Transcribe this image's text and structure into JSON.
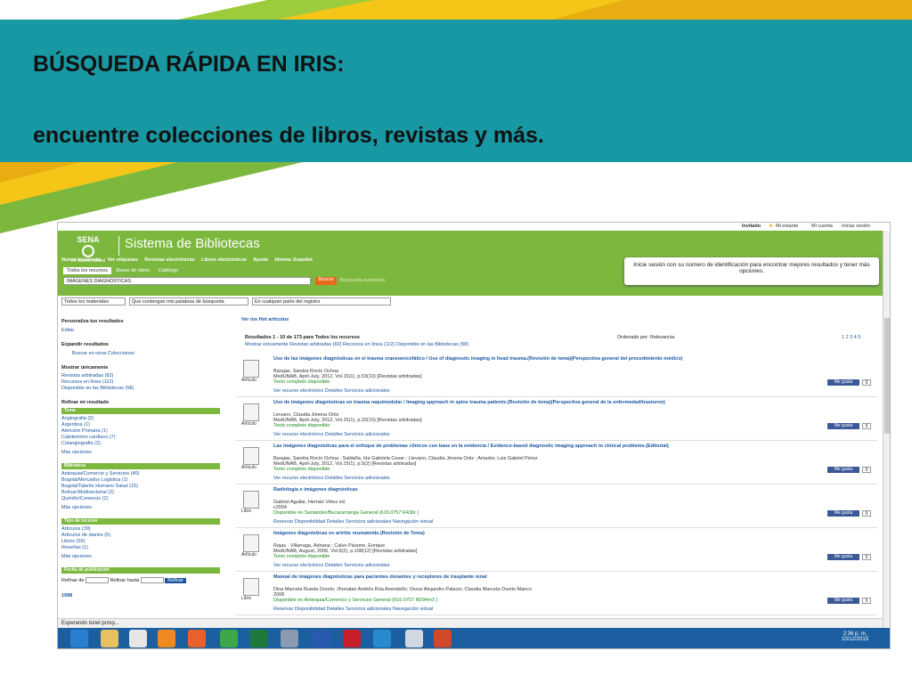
{
  "slide": {
    "title1": "BÚSQUEDA  RÁPIDA EN IRIS:",
    "title2": "encuentre colecciones de libros, revistas y más."
  },
  "topbar": {
    "invitado": "Invitado",
    "estante": "Mi estante",
    "cuenta": "Mi cuenta",
    "iniciar": "Iniciar sesión"
  },
  "header": {
    "logo_text": "SENA",
    "logo_sub": "De clase mundial",
    "system_title": "Sistema de Bibliotecas",
    "nav": [
      "Nueva búsqueda",
      "Ver etiquetas",
      "Revistas electrónicas",
      "Libros electrónicos",
      "Ayuda",
      "Idioma: Español"
    ],
    "tabs": [
      "Todos los recursos",
      "Bases de datos",
      "Catálogo"
    ],
    "search_value": "IMÁGENES DIAGNÓSTICAS",
    "search_button": "Buscar",
    "advanced": "Búsqueda avanzada",
    "login_message": "Inicie sesión con su número de identificación para encontrar mejores resultados y tener más opciones."
  },
  "filters": [
    "Todos los materiales",
    "Que contengan mis palabras de búsqueda",
    "En cualquier parte del registro"
  ],
  "sidebar": {
    "personaliza": "Personaliza tus resultados",
    "editar": "Editar",
    "expandir": "Expandir resultados",
    "buscar_otras": "Buscar en otras Colecciones",
    "mostrar": "Mostrar únicamente",
    "mostrar_items": [
      "Revistas arbitradas (82)",
      "Recursos en línea (112)",
      "Disponible en las Bibliotecas (58)"
    ],
    "refinar": "Refinar mi resultado",
    "tema": "Tema",
    "tema_items": [
      "Angiografia (2)",
      "Argentina (1)",
      "Atención Primaria (1)",
      "Cateterismo cardíaco (7)",
      "Colangiografia (2)"
    ],
    "mas": "Más opciones",
    "biblioteca": "Biblioteca",
    "biblioteca_items": [
      "Antioquia/Comercio y Servicios (40)",
      "Bogotá/Mercados Logistica (1)",
      "Bogotá/Talento Humano Salud (15)",
      "Bolívar/Multisectorial (2)",
      "Quindío/Comercio (2)"
    ],
    "tipo": "Tipo de recurso",
    "tipo_items": [
      "Artículos (39)",
      "Artículos de diarios (5)",
      "Libros (59)",
      "Reseñas (1)"
    ],
    "fecha": "Fecha de publicación",
    "refinar_de": "Refinar de",
    "refinar_hasta": "Refinar hasta",
    "refinar_btn": "Refinar",
    "year": "1998"
  },
  "results": {
    "ver": "Ver los Hot artículos",
    "summary": "Resultados 1 - 10 de 173  para Todos los recursos",
    "mostrar_line": "Mostrar únicamente   Revistas arbitradas (82)   Recursos en línea (112)   Disponible en las Bibliotecas (58)",
    "orden": "Ordenado por: Relevancia",
    "pages": "1 2 3 4 5",
    "items": [
      {
        "type": "Artículo",
        "title": "Uso de las imágenes diagnósticas en el trauma craneoencefálico / Use of diagnostic imaging in head trauma.(Revisión de tema)(Perspectiva general del procedimiento médico)",
        "authors": "Barajas, Sandra Rocío Ochoa",
        "source": "MedUNAB, April-July, 2012, Vol.15(1), p.53(10) [Revistas arbitradas]",
        "avail": "Texto completo disponible",
        "links": "Ver recurso electrónico    Detalles    Servicios adicionales"
      },
      {
        "type": "Artículo",
        "title": "Uso de imágenes diagnósticas en trauma raquimedular / Imaging approach in spine trauma patients.(Revisión de tema)(Perspectiva general de la enfermedad/trastorno)",
        "authors": "Llevano, Claudia Jimena Ortiz",
        "source": "MedUNAB, April-July, 2012, Vol.15(1), p.22(10) [Revistas arbitradas]",
        "avail": "Texto completo disponible",
        "links": "Ver recurso electrónico    Detalles    Servicios adicionales"
      },
      {
        "type": "Artículo",
        "title": "Las imágenes diagnósticas para el enfoque de problemas clínicos con base en la evidencia / Evidence-based diagnostic imaging approach to clinical problems.(Editorial)",
        "authors": "Barajas, Sandra Rocío Ochoa ; Saldaña, Ida Gabriela Cesar ; Llevano, Claudia Jimena Ortiz ; Amador, Luis Gabriel Pérez",
        "source": "MedUNAB, April-July, 2012, Vol.15(1), p.5(2) [Revistas arbitradas]",
        "avail": "Texto completo disponible",
        "links": "Ver recurso electrónico    Detalles    Servicios adicionales"
      },
      {
        "type": "Libro",
        "title": "Radiología e imágenes diagnósticas",
        "authors": "Gabriel Aguilar, Hernán Vélez ed.",
        "source": "c2004",
        "avail": "Disponible en Santander/Bucaramanga General (616.0757 R436r )",
        "links": "Reservar    Disponibilidad    Detalles    Servicios adicionales    Navegación virtual"
      },
      {
        "type": "Artículo",
        "title": "Imágenes diagnósticas en artritis reumatoide.(Revisión de Tema)",
        "authors": "Rojas - Villarraga, Adriana ; Calvo Páramo, Enrique",
        "source": "MedUNAB, August, 2006, Vol.9(2), p.108(12) [Revistas arbitradas]",
        "avail": "Texto completo disponible",
        "links": "Ver recurso electrónico    Detalles    Servicios adicionales"
      },
      {
        "type": "Libro",
        "title": "Manual de imágenes diagnósticas para pacientes donantes y receptores de trasplante renal",
        "authors": "Dina Marcela Rueda Osorio; Jhonatan Andrés Rúa Avendaño; Oscar Alejandro Palacio; Claudia Marcela Osorio Manco",
        "source": "2008",
        "avail": "Disponible en Antioquia/Comercio y Servicios General (616.0757 M294m3 )",
        "links": "Reservar    Disponibilidad    Detalles    Servicios adicionales    Navegación virtual"
      }
    ],
    "fb_label": "Me gusta",
    "fb_count": "0"
  },
  "status": "Esperando túnel proxy...",
  "clock": {
    "time": "2:36 p. m.",
    "date": "10/12/2015"
  },
  "colors": {
    "band": "#1798a3",
    "green": "#7cb73e",
    "yellow": "#f5c518"
  }
}
